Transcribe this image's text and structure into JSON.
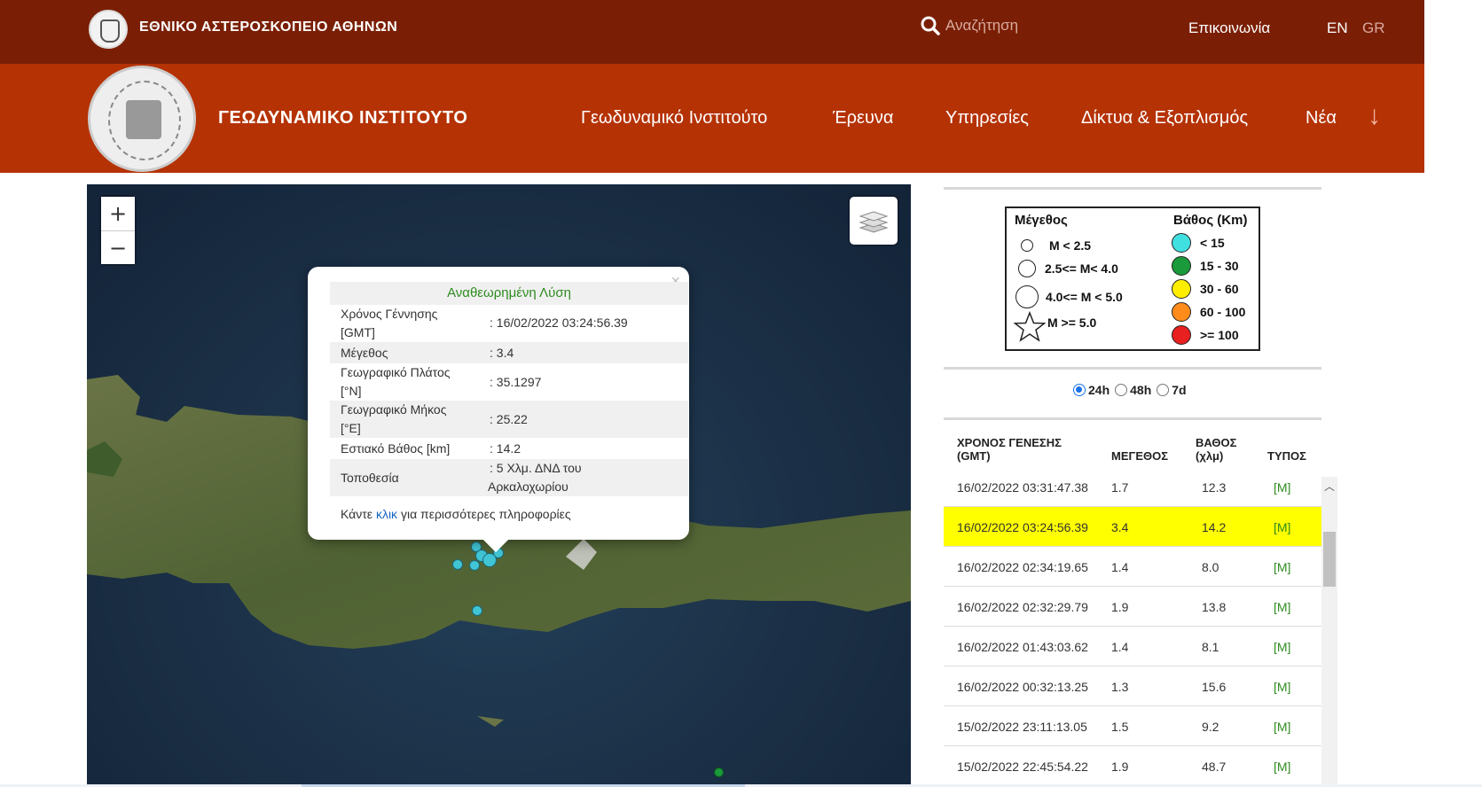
{
  "topbar": {
    "org_name": "ΕΘΝΙΚΟ ΑΣΤΕΡΟΣΚΟΠΕΙΟ ΑΘΗΝΩΝ",
    "search_placeholder": "Αναζήτηση",
    "contact": "Επικοινωνία",
    "lang_en": "EN",
    "lang_gr": "GR"
  },
  "navbar": {
    "institute": "ΓΕΩΔΥΝΑΜΙΚΟ ΙΝΣΤΙΤΟΥΤΟ",
    "items": [
      "Γεωδυναμικό Ινστιτούτο",
      "Έρευνα",
      "Υπηρεσίες",
      "Δίκτυα & Εξοπλισμός",
      "Νέα"
    ],
    "more_icon": "down-arrow-icon"
  },
  "map": {
    "zoom_in": "+",
    "zoom_out": "−",
    "layers_icon": "layers-icon"
  },
  "popup": {
    "title": "Αναθεωρημένη Λύση",
    "close": "×",
    "rows": [
      {
        "label_1": "Χρόνος Γέννησης",
        "label_2": "[GMT]",
        "value_1": ": 16/02/2022 03:24:56.39",
        "value_2": ""
      },
      {
        "label_1": "Μέγεθος",
        "label_2": "",
        "value_1": ": 3.4",
        "value_2": ""
      },
      {
        "label_1": "Γεωγραφικό Πλάτος",
        "label_2": "[°N]",
        "value_1": ": 35.1297",
        "value_2": ""
      },
      {
        "label_1": "Γεωγραφικό Μήκος",
        "label_2": "[°E]",
        "value_1": ": 25.22",
        "value_2": ""
      },
      {
        "label_1": "Εστιακό Βάθος [km]",
        "label_2": "",
        "value_1": ": 14.2",
        "value_2": ""
      },
      {
        "label_1": "Τοποθεσία",
        "label_2": "",
        "value_1": ": 5 Χλμ. ΔΝΔ του",
        "value_2": "Αρκαλοχωρίου"
      }
    ],
    "more_prefix": "Κάντε",
    "more_link": "κλικ",
    "more_suffix": "για περισσότερες πληροφορίες"
  },
  "legend": {
    "magnitude_title": "Μέγεθος",
    "depth_title": "Βάθος (Km)",
    "magnitude_items": [
      "Μ < 2.5",
      "2.5<= Μ< 4.0",
      "4.0<= Μ < 5.0",
      "Μ >= 5.0"
    ],
    "depth_items": [
      {
        "label": "< 15",
        "color": "#41e0e0"
      },
      {
        "label": "15 - 30",
        "color": "#1a9a3a"
      },
      {
        "label": "30 - 60",
        "color": "#ffee00"
      },
      {
        "label": "60 - 100",
        "color": "#ff8c1a"
      },
      {
        "label": ">= 100",
        "color": "#e82020"
      }
    ]
  },
  "period": {
    "options": [
      "24h",
      "48h",
      "7d"
    ],
    "selected": "24h"
  },
  "table": {
    "headers": {
      "time_1": "ΧΡΟΝΟΣ ΓΕΝΕΣΗΣ",
      "time_2": "(GMT)",
      "magnitude": "ΜΕΓΕΘΟΣ",
      "depth_1": "ΒΑΘΟΣ",
      "depth_2": "(χλμ)",
      "type": "ΤΥΠΟΣ"
    },
    "rows": [
      {
        "time": "16/02/2022 03:31:47.38",
        "magnitude": "1.7",
        "depth": "12.3",
        "type": "[M]"
      },
      {
        "time": "16/02/2022 03:24:56.39",
        "magnitude": "3.4",
        "depth": "14.2",
        "type": "[M]"
      },
      {
        "time": "16/02/2022 02:34:19.65",
        "magnitude": "1.4",
        "depth": "8.0",
        "type": "[M]"
      },
      {
        "time": "16/02/2022 02:32:29.79",
        "magnitude": "1.9",
        "depth": "13.8",
        "type": "[M]"
      },
      {
        "time": "16/02/2022 01:43:03.62",
        "magnitude": "1.4",
        "depth": "8.1",
        "type": "[M]"
      },
      {
        "time": "16/02/2022 00:32:13.25",
        "magnitude": "1.3",
        "depth": "15.6",
        "type": "[M]"
      },
      {
        "time": "15/02/2022 23:11:13.05",
        "magnitude": "1.5",
        "depth": "9.2",
        "type": "[M]"
      },
      {
        "time": "15/02/2022 22:45:54.22",
        "magnitude": "1.9",
        "depth": "48.7",
        "type": "[M]"
      }
    ],
    "highlight_color": "#ffff00"
  },
  "colors": {
    "topbar": "#7a1f05",
    "navbar": "#b53204",
    "link_green": "#2e8b1f"
  }
}
